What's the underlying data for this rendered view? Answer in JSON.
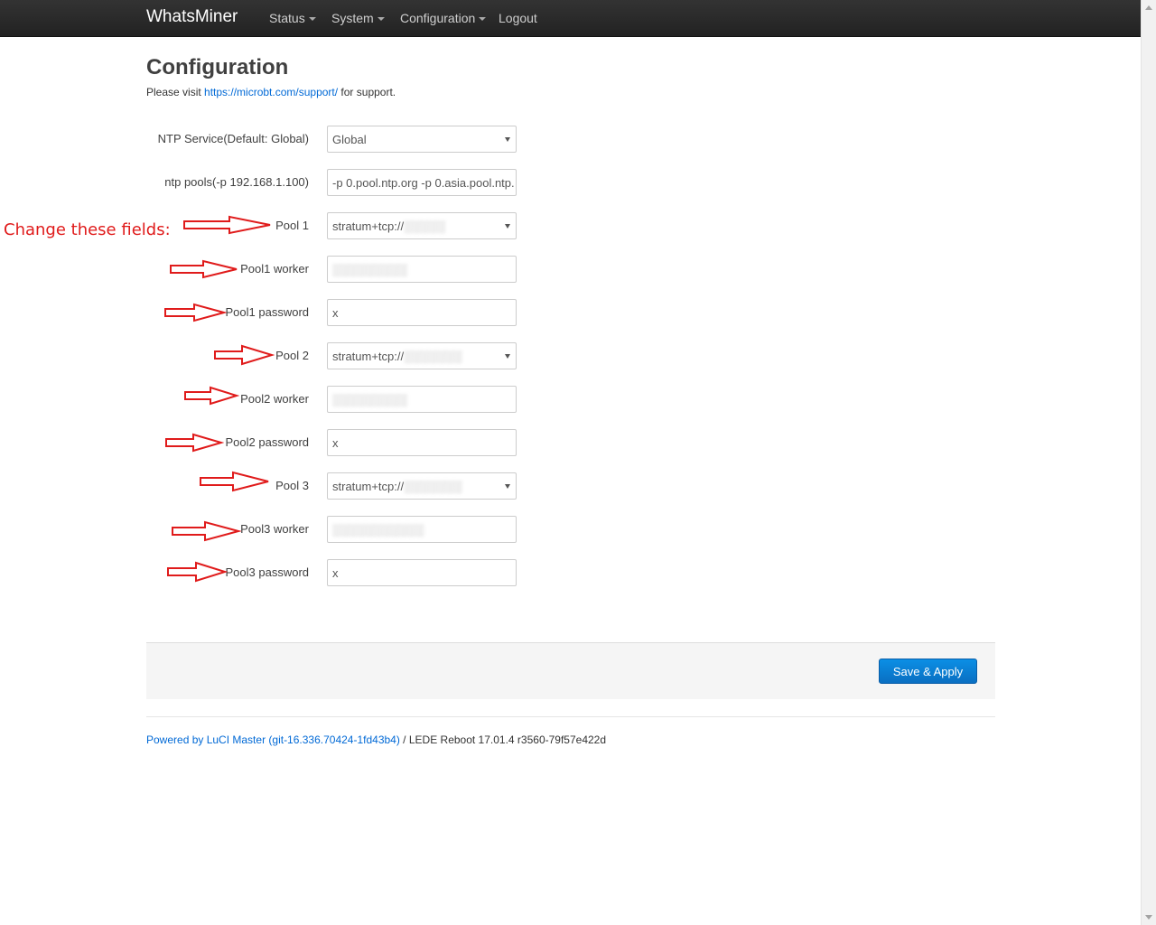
{
  "navbar": {
    "brand": "WhatsMiner",
    "items": [
      {
        "label": "Status",
        "has_dropdown": true
      },
      {
        "label": "System",
        "has_dropdown": true
      },
      {
        "label": "Configuration",
        "has_dropdown": true
      },
      {
        "label": "Logout",
        "has_dropdown": false
      }
    ]
  },
  "page": {
    "title": "Configuration",
    "support_prefix": "Please visit ",
    "support_link": "https://microbt.com/support/",
    "support_suffix": " for support."
  },
  "annotation": {
    "text": "Change these fields:",
    "color": "#e01b1b"
  },
  "form": {
    "ntp_service": {
      "label": "NTP Service(Default: Global)",
      "value": "Global"
    },
    "ntp_pools": {
      "label": "ntp pools(-p 192.168.1.100)",
      "value": "-p 0.pool.ntp.org -p 0.asia.pool.ntp."
    },
    "pool1": {
      "label": "Pool 1",
      "value": "stratum+tcp://"
    },
    "pool1_worker": {
      "label": "Pool1 worker",
      "value": ""
    },
    "pool1_password": {
      "label": "Pool1 password",
      "value": "x"
    },
    "pool2": {
      "label": "Pool 2",
      "value": "stratum+tcp://"
    },
    "pool2_worker": {
      "label": "Pool2 worker",
      "value": ""
    },
    "pool2_password": {
      "label": "Pool2 password",
      "value": "x"
    },
    "pool3": {
      "label": "Pool 3",
      "value": "stratum+tcp://"
    },
    "pool3_worker": {
      "label": "Pool3 worker",
      "value": ""
    },
    "pool3_password": {
      "label": "Pool3 password",
      "value": "x"
    }
  },
  "actions": {
    "save_apply_label": "Save & Apply"
  },
  "footer": {
    "powered_by": "Powered by LuCI Master (git-16.336.70424-1fd43b4)",
    "version": " / LEDE Reboot 17.01.4 r3560-79f57e422d"
  },
  "colors": {
    "navbar": "#222222",
    "link": "#0069d6",
    "primary_button": "#0a6fc2",
    "annotation_red": "#e01b1b"
  }
}
